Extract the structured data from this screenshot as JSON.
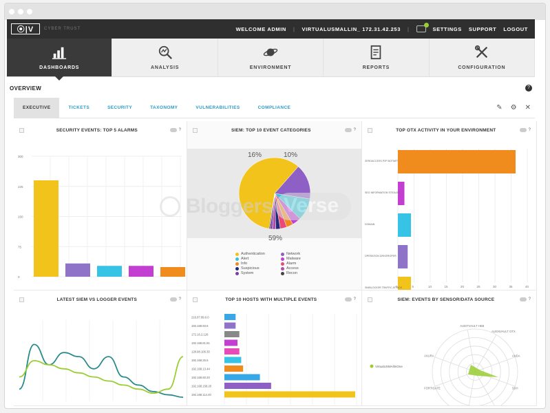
{
  "topbar": {
    "logo_text": "⦿|V",
    "logo_sub": "CYBER TRUST",
    "welcome": "WELCOME ADMIN",
    "host": "VIRTUALUSMALLIN_ 172.31.42.253",
    "settings": "SETTINGS",
    "support": "SUPPORT",
    "logout": "LOGOUT"
  },
  "nav": {
    "items": [
      {
        "label": "DASHBOARDS",
        "icon": "bar-chart-icon"
      },
      {
        "label": "ANALYSIS",
        "icon": "magnifier-chart-icon"
      },
      {
        "label": "ENVIRONMENT",
        "icon": "planet-icon"
      },
      {
        "label": "REPORTS",
        "icon": "document-icon"
      },
      {
        "label": "CONFIGURATION",
        "icon": "wrench-screwdriver-icon"
      }
    ]
  },
  "overview": {
    "title": "OVERVIEW",
    "help": "?"
  },
  "subtabs": [
    "EXECUTIVE",
    "TICKETS",
    "SECURITY",
    "TAXONOMY",
    "VULNERABILITIES",
    "COMPLIANCE"
  ],
  "tools": {
    "edit": "✎",
    "settings": "⚙",
    "close": "✕"
  },
  "panels": {
    "p1": {
      "title": "SECURITY EVENTS: TOP 5 ALARMS"
    },
    "p2": {
      "title": "SIEM: TOP 10 EVENT CATEGORIES"
    },
    "p3": {
      "title": "TOP OTX ACTIVITY IN YOUR ENVIRONMENT"
    },
    "p4": {
      "title": "LATEST SIEM VS LOGGER EVENTS"
    },
    "p5": {
      "title": "TOP 10 HOSTS WITH MULTIPLE EVENTS"
    },
    "p6": {
      "title": "SIEM: EVENTS BY SENSOR/DATA SOURCE"
    }
  },
  "pie_labels": {
    "top_left": "16%",
    "top_right": "10%",
    "bottom": "59%"
  },
  "legend": [
    {
      "label": "Authentication",
      "color": "#f2c31b"
    },
    {
      "label": "Network",
      "color": "#8e5fc4"
    },
    {
      "label": "Alert",
      "color": "#37c3d6"
    },
    {
      "label": "Malware",
      "color": "#c33fd2"
    },
    {
      "label": "Info",
      "color": "#f08c1e"
    },
    {
      "label": "Alarm",
      "color": "#e84b7a"
    },
    {
      "label": "Suspicious",
      "color": "#222a7a"
    },
    {
      "label": "Access",
      "color": "#b04fa8"
    },
    {
      "label": "System",
      "color": "#7a3fa8"
    },
    {
      "label": "Recon",
      "color": "#444444"
    }
  ],
  "radar": {
    "series_label": "VirtualUSMAllInOne",
    "axes": [
      "AUDITVAULT HEB",
      "ALIENVAULT OTX",
      "ANDA",
      "SSH",
      "ZIRCOLANA",
      "PAM_UNIX",
      "FORTIGATE",
      "AXURA"
    ]
  },
  "watermark": {
    "left": "Bloggers",
    "right": "Verse"
  },
  "chart_data": [
    {
      "type": "bar",
      "title": "SECURITY EVENTS: TOP 5 ALARMS",
      "yticks": [
        "300",
        "225",
        "150",
        "75",
        "0"
      ],
      "ylim": [
        0,
        300
      ],
      "values": [
        240,
        33,
        27,
        27,
        24
      ],
      "colors": [
        "#f2c31b",
        "#8e73c9",
        "#37c3e6",
        "#c33fd2",
        "#f08c1e"
      ]
    },
    {
      "type": "pie",
      "title": "SIEM: TOP 10 EVENT CATEGORIES",
      "values": [
        59,
        16,
        10,
        4,
        3,
        3,
        2,
        1.5,
        1,
        0.5
      ],
      "categories": [
        "Authentication",
        "Network",
        "Alert",
        "Malware",
        "Info",
        "Alarm",
        "Suspicious",
        "Access",
        "System",
        "Recon"
      ]
    },
    {
      "type": "bar",
      "orientation": "horizontal",
      "title": "TOP OTX ACTIVITY IN YOUR ENVIRONMENT",
      "categories": [
        "ZEROACCESS P2P BOTNET",
        "SEO INFORMATION STEALER",
        "DOMAIN",
        "OPERATION DRIVEROPER",
        "SIMBLOCKER TRAFFIC ATTACK"
      ],
      "values": [
        18,
        1,
        2,
        1.5,
        2
      ],
      "xticks": [
        "0",
        "5",
        "10",
        "15",
        "20",
        "25",
        "30",
        "35",
        "40"
      ],
      "colors": [
        "#f08c1e",
        "#c33fd2",
        "#37c3e6",
        "#8e73c9",
        "#f2c31b"
      ]
    },
    {
      "type": "line",
      "title": "LATEST SIEM VS LOGGER EVENTS",
      "series": [
        {
          "name": "SIEM",
          "values": [
            0.15,
            0.7,
            0.45,
            0.6,
            0.55,
            0.4,
            0.55,
            0.3,
            0.2,
            0.12,
            0.08,
            0.05
          ]
        },
        {
          "name": "Logger",
          "values": [
            0.3,
            0.5,
            0.45,
            0.4,
            0.35,
            0.3,
            0.25,
            0.2,
            0.15,
            0.1,
            0.15,
            0.55
          ]
        }
      ]
    },
    {
      "type": "bar",
      "orientation": "horizontal",
      "title": "TOP 10 HOSTS WITH MULTIPLE EVENTS",
      "categories": [
        "216.87.89.0.0",
        "192.168.93.6",
        "172.16.2.126",
        "192.168.81.81",
        "128.98.106.30",
        "192.168.25.5",
        "192.168.13.44",
        "192.168.60.20",
        "192.168.158.20",
        "192.168.114.40"
      ],
      "values": [
        6,
        6,
        8,
        7,
        8,
        9,
        10,
        19,
        25,
        70
      ],
      "colors": [
        "#37a7e6",
        "#8e73c9",
        "#888888",
        "#c33fd2",
        "#e84bb8",
        "#37c3e6",
        "#f08c1e",
        "#37a7e6",
        "#8e5fc4",
        "#f2c31b"
      ]
    }
  ]
}
